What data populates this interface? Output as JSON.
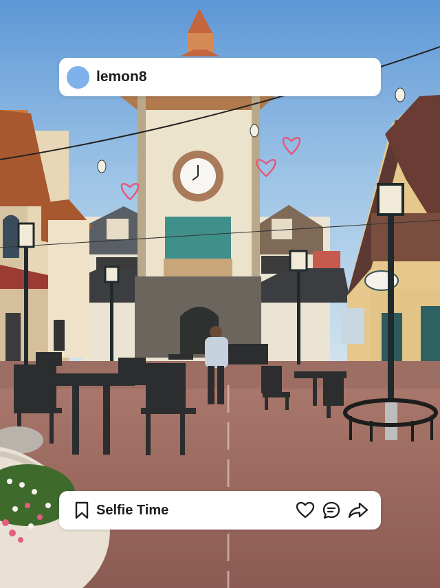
{
  "post": {
    "app_name": "lemon8",
    "caption": "Selfie Time"
  },
  "icons": {
    "avatar": "avatar-circle",
    "bookmark": "bookmark-icon",
    "like": "heart-icon",
    "comment": "comment-icon",
    "share": "share-icon"
  },
  "colors": {
    "avatar": "#7fb1ea",
    "hearts": "#e8557a",
    "card": "#ffffff"
  }
}
